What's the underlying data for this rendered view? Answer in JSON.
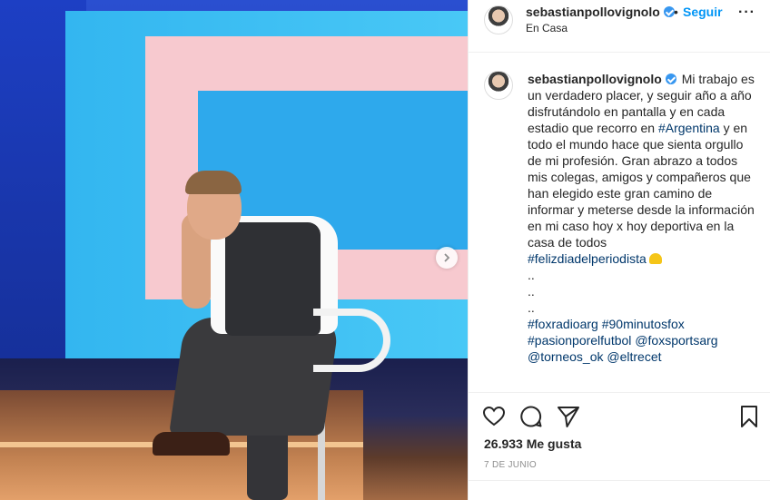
{
  "post": {
    "username": "sebastianpollovignolo",
    "verified": true,
    "dot": "•",
    "follow_label": "Seguir",
    "location": "En Casa",
    "more_icon": "more-horizontal-icon"
  },
  "caption": {
    "username": "sebastianpollovignolo",
    "text_1": "Mi trabajo es un verdadero placer, y seguir año a año disfrutándolo en pantalla y en cada estadio que recorro en ",
    "tag_argentina": "#Argentina",
    "text_2": " y en todo el mundo hace que sienta orgullo de mi profesión. Gran abrazo a todos mis colegas, amigos y compañeros que han elegido este gran camino de informar y meterse desde la información en mi caso hoy x hoy deportiva en la casa de todos",
    "tag_feliz": "#felizdiadelperiodista",
    "dots": [
      "..",
      "..",
      ".."
    ],
    "tag_foxradio": "#foxradioarg",
    "tag_90min": "#90minutosfox",
    "tag_pasion": "#pasionporelfutbol",
    "mention_foxsports": "@foxsportsarg",
    "mention_torneos": "@torneos_ok",
    "mention_eltrece": "@eltrecet"
  },
  "footer": {
    "likes": "26.933 Me gusta",
    "date": "7 DE JUNIO"
  },
  "colors": {
    "link": "#00376b",
    "follow": "#0095f6",
    "verified": "#3897f0"
  }
}
